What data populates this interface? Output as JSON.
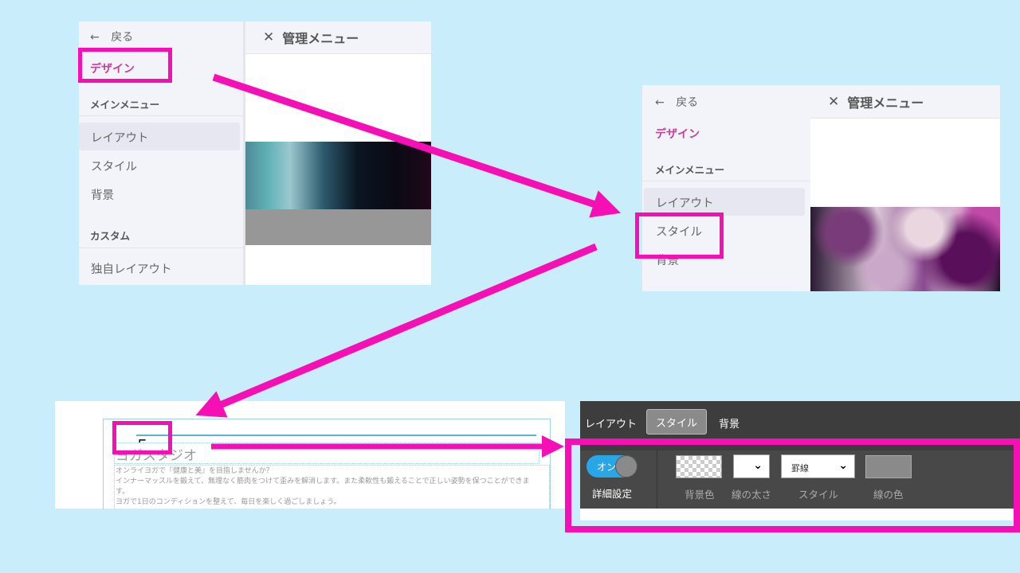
{
  "panel1": {
    "back_label": "戻る",
    "design_label": "デザイン",
    "section_main": "メインメニュー",
    "items": [
      "レイアウト",
      "スタイル",
      "背景"
    ],
    "section_custom": "カスタム",
    "custom_item": "独自レイアウト",
    "menu_title": "管理メニュー"
  },
  "panel2": {
    "back_label": "戻る",
    "design_label": "デザイン",
    "section_main": "メインメニュー",
    "items": [
      "レイアウト",
      "スタイル",
      "背景"
    ],
    "menu_title": "管理メニュー"
  },
  "preview": {
    "site_title": "ヨガスタジオ",
    "lines": [
      "オンライヨガで『健康と美』を目指しませんか？",
      "インナーマッスルを鍛えて、無理なく筋肉をつけて歪みを解消します。また柔軟性も鍛えることで正しい姿勢を保つことができま",
      "す。",
      "ヨガで1日のコンディションを整えて、毎日を楽しく過ごしましょう。"
    ]
  },
  "toolbar": {
    "tabs": [
      "レイアウト",
      "スタイル",
      "背景"
    ],
    "active_tab": 1,
    "toggle_label": "オン",
    "advanced_label": "詳細設定",
    "controls": {
      "bg_color": "背景色",
      "line_width": "線の太さ",
      "style": "スタイル",
      "line_color": "線の色"
    },
    "style_value": "罫線"
  },
  "colors": {
    "background": "#c9edfb",
    "highlight": "#f50fb5",
    "design_accent": "#c8409a",
    "toggle_on": "#29a6e6"
  },
  "icons": {
    "back": "arrow-left-icon",
    "close": "close-icon",
    "chevron": "chevron-down-icon",
    "cursor": "paint-roller-icon"
  }
}
